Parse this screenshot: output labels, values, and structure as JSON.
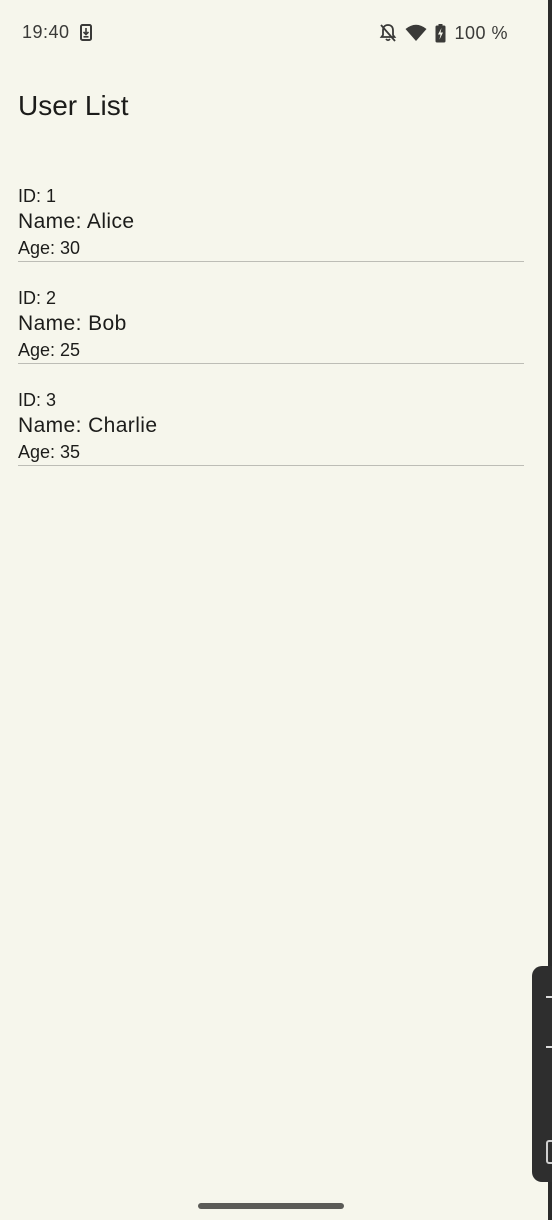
{
  "status_bar": {
    "time": "19:40",
    "battery": "100 %",
    "icons": [
      "download-notification-icon",
      "bell-off-icon",
      "wifi-icon",
      "battery-charging-icon"
    ]
  },
  "page": {
    "title": "User List"
  },
  "users": [
    {
      "id": "ID: 1",
      "name": "Name: Alice",
      "age": "Age: 30"
    },
    {
      "id": "ID: 2",
      "name": "Name: Bob",
      "age": "Age: 25"
    },
    {
      "id": "ID: 3",
      "name": "Name: Charlie",
      "age": "Age: 35"
    }
  ],
  "colors": {
    "background": "#f6f6ec",
    "text": "#1c1c1a",
    "divider": "#bdbdb6"
  }
}
